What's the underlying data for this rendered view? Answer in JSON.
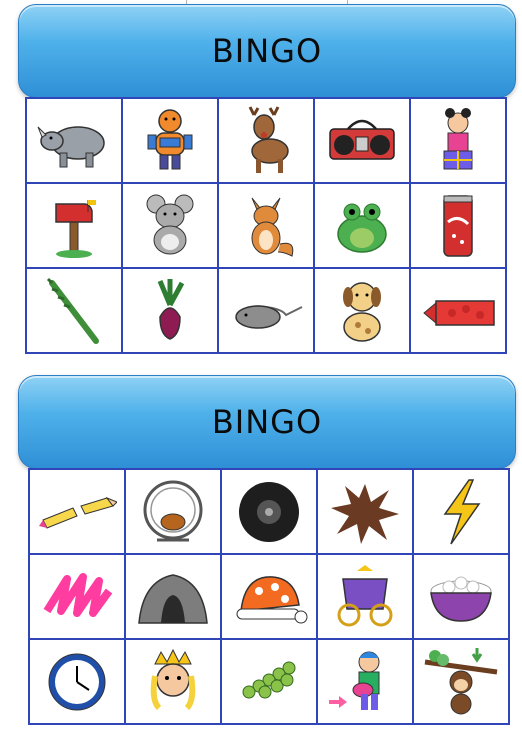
{
  "cards": [
    {
      "title": "BINGO",
      "cells": [
        "rhino-icon",
        "robot-icon",
        "reindeer-icon",
        "radio-icon",
        "ribbon-girl-icon",
        "mailbox-icon",
        "mouse-icon",
        "fox-icon",
        "frog-icon",
        "soda-can-icon",
        "asparagus-icon",
        "beet-icon",
        "stingray-icon",
        "dog-icon",
        "crayon-icon"
      ]
    },
    {
      "title": "BINGO",
      "cells": [
        "broken-pencil-icon",
        "hamster-wheel-icon",
        "tire-icon",
        "splat-icon",
        "lightning-icon",
        "scribble-icon",
        "cave-icon",
        "nightcap-icon",
        "carriage-icon",
        "popcorn-bowl-icon",
        "clock-icon",
        "queen-icon",
        "grapes-icon",
        "guitar-kid-icon",
        "monkey-icon"
      ]
    }
  ],
  "colors": {
    "banner": "#4fb1ea",
    "gridline": "#2f45b8"
  }
}
